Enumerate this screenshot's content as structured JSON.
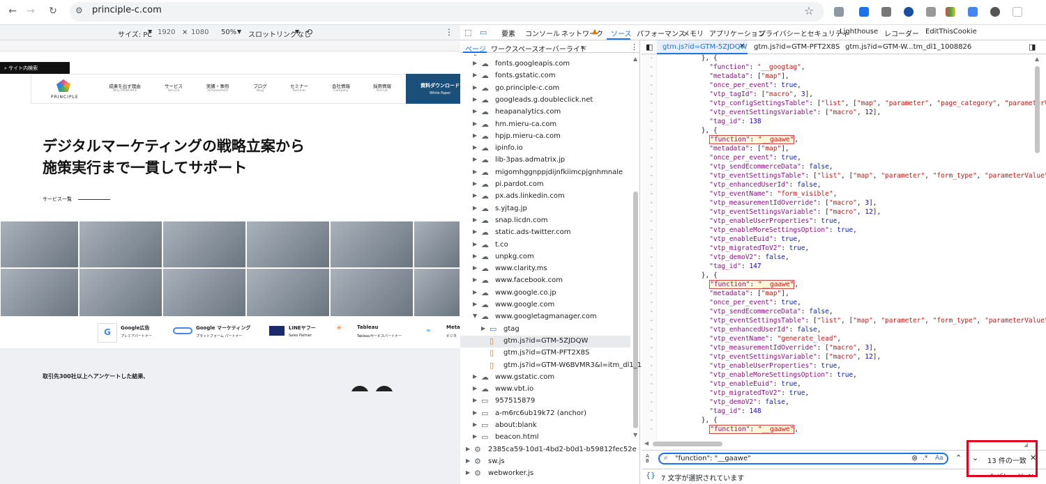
{
  "browser": {
    "url": "principle-c.com",
    "icons": [
      "back-icon",
      "forward-icon",
      "reload-icon",
      "site-info-icon",
      "star-icon"
    ],
    "extensions": [
      "ext1",
      "ext2",
      "ext3",
      "ext4",
      "ext5",
      "ext6",
      "ext7",
      "ext8",
      "ext9"
    ]
  },
  "device_toolbar": {
    "size_label": "サイズ: PC",
    "width": "1920",
    "times": "×",
    "height": "1080",
    "zoom": "50%",
    "throttle": "スロットリングなし"
  },
  "site": {
    "search_placeholder": "サイト内検索",
    "logo_text": "PRINCIPLE",
    "nav": [
      {
        "jp": "成果を出す理由",
        "en": "Why PRINCIPLE"
      },
      {
        "jp": "サービス",
        "en": "Service"
      },
      {
        "jp": "実績・事例",
        "en": "Achievement"
      },
      {
        "jp": "ブログ",
        "en": "Blog"
      },
      {
        "jp": "セミナー",
        "en": "Seminar"
      },
      {
        "jp": "会社情報",
        "en": "Company"
      },
      {
        "jp": "採用情報",
        "en": "Recruit"
      }
    ],
    "cta": {
      "jp": "資料ダウンロード",
      "en": "White Paper"
    },
    "hero_line1": "デジタルマーケティングの戦略立案から",
    "hero_line2": "施策実行まで一貫してサポート",
    "service_link": "サービス一覧",
    "partners": [
      {
        "name": "Google広告",
        "sub": "プレミアパートナー"
      },
      {
        "name": "Google マーケティング",
        "sub": "プラットフォーム パートナー"
      },
      {
        "name": "LINEヤフー",
        "sub": "Sales Partner"
      },
      {
        "name": "Tableau",
        "sub": "Tableauサービスパートナー"
      },
      {
        "name": "Meta",
        "sub": "ビジネ"
      }
    ],
    "survey_text": "取引先300社以上へアンケートした結果、"
  },
  "devtools": {
    "tabs": [
      "要素",
      "コンソール",
      "ネットワーク",
      "ソース",
      "パフォーマンス",
      "メモリ",
      "アプリケーション",
      "プライバシーとセキュリティ",
      "Lighthouse",
      "レコーダー",
      "EditThisCookie"
    ],
    "active_tab": "ソース",
    "nav_tabs": [
      "ページ",
      "ワークスペース",
      "オーバーライド"
    ],
    "file_tabs": [
      "gtm.js?id=GTM-5ZJDQW",
      "gtm.js?id=GTM-PFT2X8S",
      "gtm.js?id=GTM-W...tm_dl1_1008826"
    ],
    "tree": [
      {
        "label": "fonts.googleapis.com",
        "type": "cloud"
      },
      {
        "label": "fonts.gstatic.com",
        "type": "cloud"
      },
      {
        "label": "go.principle-c.com",
        "type": "cloud"
      },
      {
        "label": "googleads.g.doubleclick.net",
        "type": "cloud"
      },
      {
        "label": "heapanalytics.com",
        "type": "cloud"
      },
      {
        "label": "hm.mieru-ca.com",
        "type": "cloud"
      },
      {
        "label": "hpjp.mieru-ca.com",
        "type": "cloud"
      },
      {
        "label": "ipinfo.io",
        "type": "cloud"
      },
      {
        "label": "lib-3pas.admatrix.jp",
        "type": "cloud"
      },
      {
        "label": "migomhggnppjdijnfkiimcpjgnhmnale",
        "type": "cloud"
      },
      {
        "label": "pi.pardot.com",
        "type": "cloud"
      },
      {
        "label": "px.ads.linkedin.com",
        "type": "cloud"
      },
      {
        "label": "s.yjtag.jp",
        "type": "cloud"
      },
      {
        "label": "snap.licdn.com",
        "type": "cloud"
      },
      {
        "label": "static.ads-twitter.com",
        "type": "cloud"
      },
      {
        "label": "t.co",
        "type": "cloud"
      },
      {
        "label": "unpkg.com",
        "type": "cloud"
      },
      {
        "label": "www.clarity.ms",
        "type": "cloud"
      },
      {
        "label": "www.facebook.com",
        "type": "cloud"
      },
      {
        "label": "www.google.co.jp",
        "type": "cloud"
      },
      {
        "label": "www.google.com",
        "type": "cloud"
      },
      {
        "label": "www.googletagmanager.com",
        "type": "cloud-open"
      },
      {
        "label": "gtag",
        "type": "folder"
      },
      {
        "label": "gtm.js?id=GTM-5ZJDQW",
        "type": "file-selected"
      },
      {
        "label": "gtm.js?id=GTM-PFT2X8S",
        "type": "file"
      },
      {
        "label": "gtm.js?id=GTM-W6BVMR3&l=itm_dl1_1...",
        "type": "file"
      },
      {
        "label": "www.gstatic.com",
        "type": "cloud"
      },
      {
        "label": "www.vbt.io",
        "type": "cloud"
      },
      {
        "label": "957515879",
        "type": "frame"
      },
      {
        "label": "a-m6rc6ub19k72 (anchor)",
        "type": "frame"
      },
      {
        "label": "about:blank",
        "type": "frame"
      },
      {
        "label": "beacon.html",
        "type": "frame"
      },
      {
        "label": "2385ca59-10d1-4bd2-b0d1-b59812fec52e",
        "type": "worker"
      },
      {
        "label": "sw.js",
        "type": "worker"
      },
      {
        "label": "webworker.js",
        "type": "worker"
      }
    ],
    "search_query": "\"function\": \"__gaawe\"",
    "match_count": "13 件の一致",
    "status_text": "7 文字が選択されています",
    "clipped_text": "カバレッジ: N/A",
    "regex_label": ".*",
    "case_label": "Aa"
  }
}
